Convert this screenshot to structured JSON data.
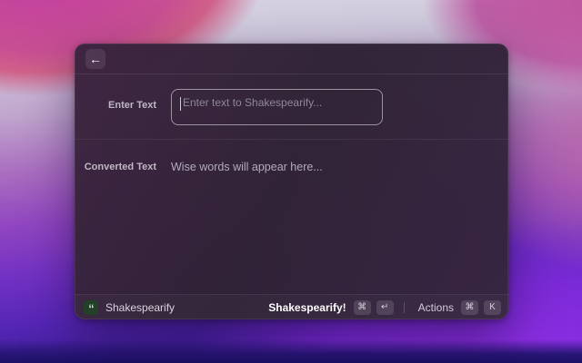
{
  "window": {
    "header": {
      "back_icon": "←"
    },
    "form": {
      "enter_text_label": "Enter Text",
      "input_placeholder": "Enter text to Shakespearify...",
      "converted_text_label": "Converted Text",
      "converted_text_value": "Wise words will appear here..."
    },
    "footer": {
      "app_icon_glyph": "“",
      "app_title": "Shakespearify",
      "primary_action": {
        "label": "Shakespearify!",
        "keys": [
          "⌘",
          "↵"
        ]
      },
      "actions_menu": {
        "label": "Actions",
        "keys": [
          "⌘",
          "K"
        ]
      }
    }
  },
  "colors": {
    "window_bg": "#32243a",
    "wallpaper_top": "#d8d5e4",
    "wallpaper_magenta": "#c23da4",
    "wallpaper_violet": "#7c2ad8",
    "wallpaper_bottom": "#1c1166",
    "input_border": "#f0edf5",
    "app_icon_bg": "#234028",
    "app_icon_fg": "#cdeacc"
  }
}
